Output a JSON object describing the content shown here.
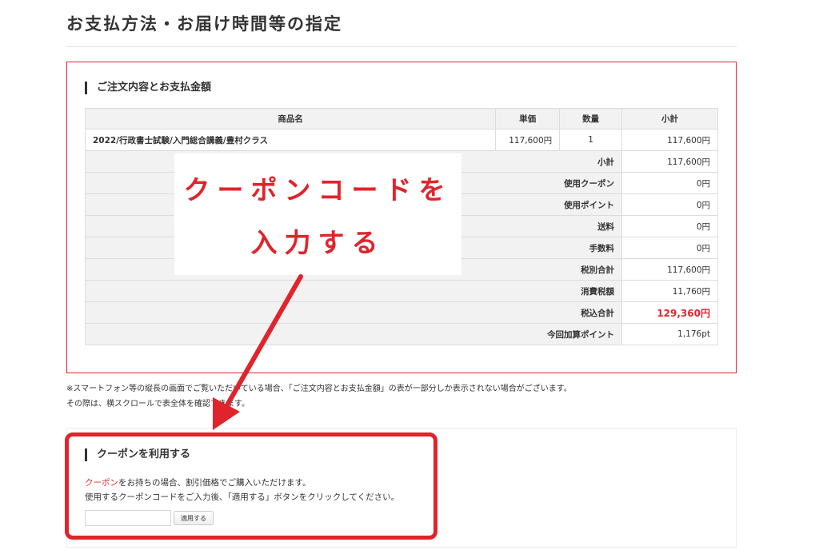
{
  "page": {
    "title": "お支払方法・お届け時間等の指定"
  },
  "order": {
    "heading": "ご注文内容とお支払金額",
    "headers": {
      "name": "商品名",
      "unit_price": "単価",
      "qty": "数量",
      "subtotal": "小計"
    },
    "item": {
      "name": "2022/行政書士試験/入門総合講義/豊村クラス",
      "unit_price": "117,600円",
      "qty": "1",
      "subtotal": "117,600円"
    },
    "summary": [
      {
        "label": "小計",
        "value": "117,600円"
      },
      {
        "label": "使用クーポン",
        "value": "0円"
      },
      {
        "label": "使用ポイント",
        "value": "0円"
      },
      {
        "label": "送料",
        "value": "0円"
      },
      {
        "label": "手数料",
        "value": "0円"
      },
      {
        "label": "税別合計",
        "value": "117,600円"
      },
      {
        "label": "消費税額",
        "value": "11,760円"
      },
      {
        "label": "税込合計",
        "value": "129,360円"
      },
      {
        "label": "今回加算ポイント",
        "value": "1,176pt"
      }
    ]
  },
  "notes": {
    "line1": "※スマートフォン等の縦長の画面でご覧いただいている場合、「ご注文内容とお支払金額」の表が一部分しか表示されない場合がございます。",
    "line2": "その際は、横スクロールで表全体を確認できます。"
  },
  "coupon": {
    "heading": "クーポンを利用する",
    "highlight_word": "クーポン",
    "text1_rest": "をお持ちの場合、割引価格でご購入いただけます。",
    "text2": "使用するクーポンコードをご入力後、「適用する」ボタンをクリックしてください。",
    "input_value": "",
    "apply_label": "適用する"
  },
  "annotation": {
    "line1": "クーポンコードを",
    "line2": "入力する",
    "accent_color": "#e0242b"
  }
}
